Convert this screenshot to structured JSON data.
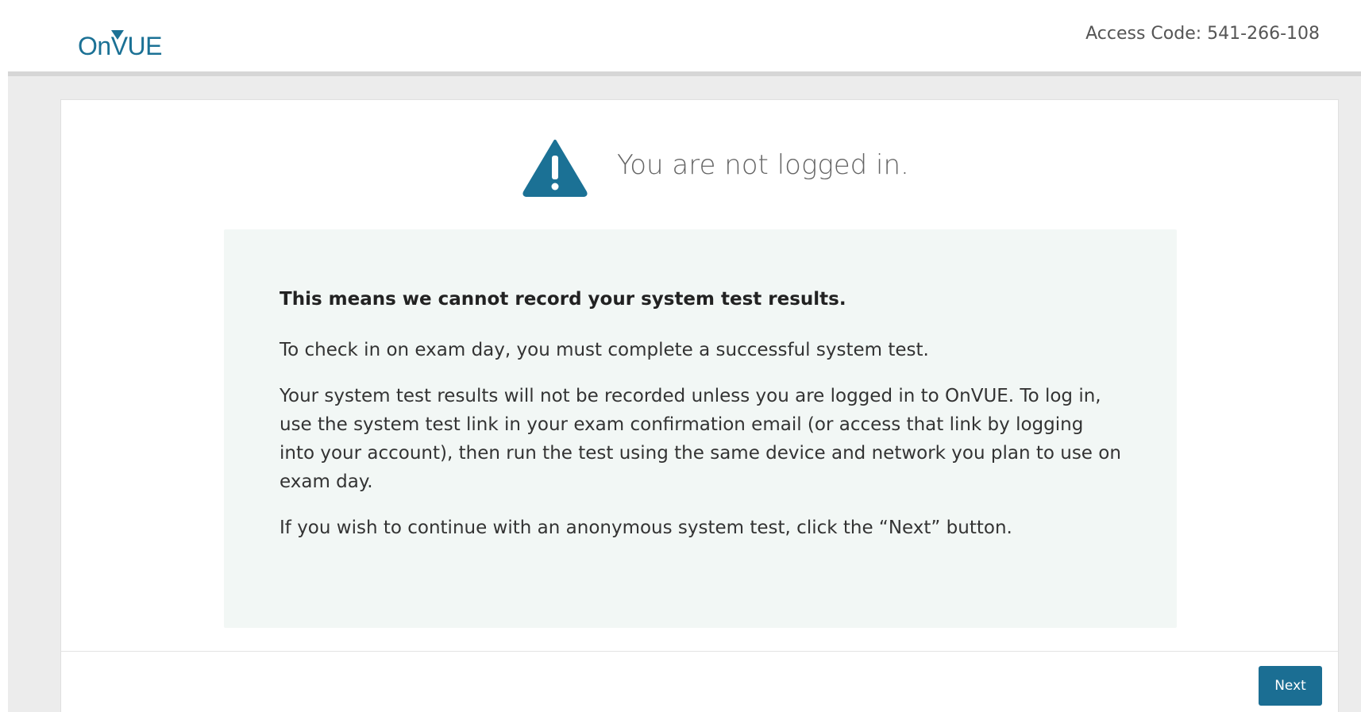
{
  "header": {
    "logo_on": "On",
    "logo_vue": "VUE",
    "access_code": "Access Code: 541-266-108"
  },
  "main": {
    "title": "You are not logged in.",
    "icon": "warning-triangle-icon",
    "paragraphs": {
      "p0": "This means we cannot record your system test results.",
      "p1": "To check in on exam day, you must complete a successful system test.",
      "p2": "Your system test results will not be recorded unless you are logged in to OnVUE. To log in, use the system test link in your exam confirmation email (or access that link by logging into your account), then run the test using the same device and network you plan to use on exam day.",
      "p3": "If you wish to continue with an anonymous system test, click the “Next” button."
    }
  },
  "footer": {
    "next_label": "Next"
  },
  "colors": {
    "brand": "#1b7195",
    "button": "#1b6e93",
    "info_bg": "#f2f7f5",
    "page_bg": "#ececec"
  }
}
